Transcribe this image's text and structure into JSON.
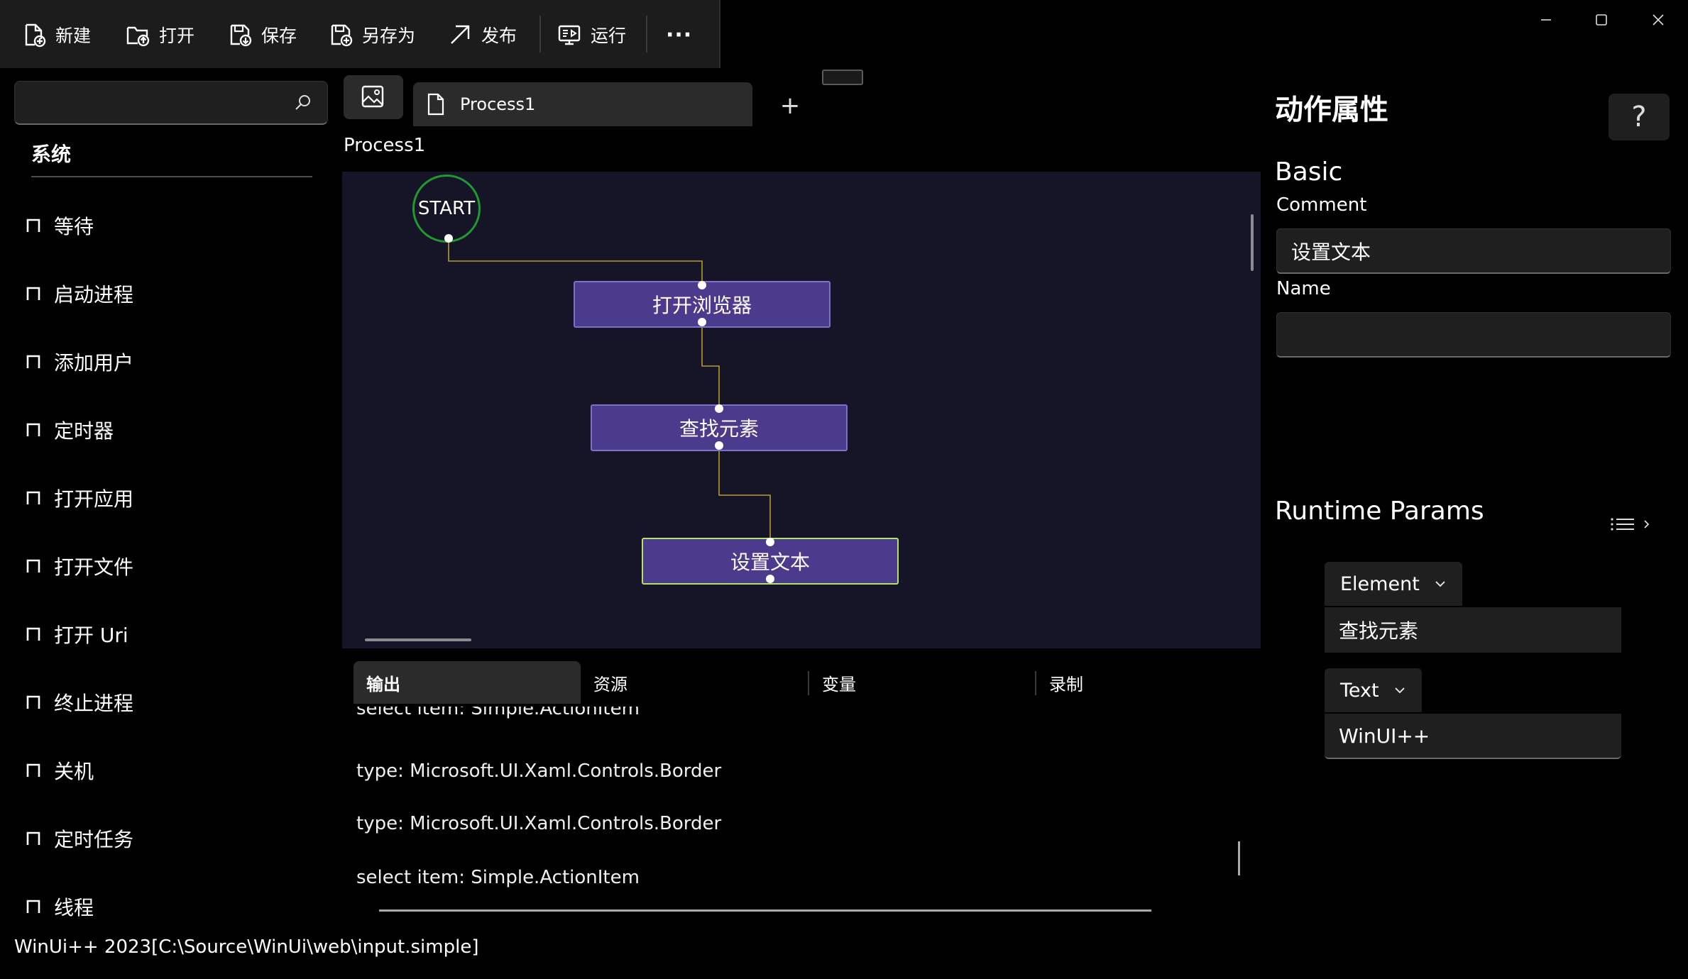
{
  "toolbar": {
    "new_label": "新建",
    "open_label": "打开",
    "save_label": "保存",
    "save_as_label": "另存为",
    "publish_label": "发布",
    "run_label": "运行",
    "more_label": "···"
  },
  "search": {
    "placeholder": ""
  },
  "sidebar": {
    "title": "系统",
    "items": [
      {
        "label": "等待"
      },
      {
        "label": "启动进程"
      },
      {
        "label": "添加用户"
      },
      {
        "label": "定时器"
      },
      {
        "label": "打开应用"
      },
      {
        "label": "打开文件"
      },
      {
        "label": "打开 Uri"
      },
      {
        "label": "终止进程"
      },
      {
        "label": "关机"
      },
      {
        "label": "定时任务"
      },
      {
        "label": "线程"
      }
    ]
  },
  "document": {
    "tab_label": "Process1",
    "add_tab_label": "+",
    "caption": "Process1"
  },
  "flow": {
    "start_label": "START",
    "nodes": [
      {
        "label": "打开浏览器"
      },
      {
        "label": "查找元素"
      },
      {
        "label": "设置文本"
      }
    ]
  },
  "bottom_tabs": {
    "output": "输出",
    "resources": "资源",
    "variables": "变量",
    "record": "录制"
  },
  "log": {
    "lines": [
      "select item: Simple.ActionItem",
      "type: Microsoft.UI.Xaml.Controls.Border",
      "type: Microsoft.UI.Xaml.Controls.Border",
      "select item: Simple.ActionItem"
    ]
  },
  "status": {
    "text": "WinUi++ 2023[C:\\Source\\WinUi\\web\\input.simple]"
  },
  "props": {
    "title": "动作属性",
    "help_label": "?",
    "basic_title": "Basic",
    "comment_label": "Comment",
    "comment_value": "设置文本",
    "name_label": "Name",
    "name_value": "",
    "runtime_title": "Runtime Params",
    "params": [
      {
        "type": "Element",
        "value": "查找元素"
      },
      {
        "type": "Text",
        "value": "WinUI++"
      }
    ]
  },
  "colors": {
    "canvas_bg": "#151527",
    "node_fill": "#4b3b8c",
    "node_border": "#7f70c8",
    "selected_border": "#b5e26b",
    "start_ring": "#1f9a2e",
    "connector": "#b59a2e"
  },
  "icons": {
    "new": "file-add-icon",
    "open": "folder-open-icon",
    "save": "save-icon",
    "save_as": "save-as-icon",
    "publish": "arrow-up-right-icon",
    "run": "monitor-run-icon",
    "search": "search-icon",
    "image_tab": "image-icon",
    "doc_tab": "document-icon",
    "help": "question-icon",
    "runtime_list": "list-icon"
  }
}
